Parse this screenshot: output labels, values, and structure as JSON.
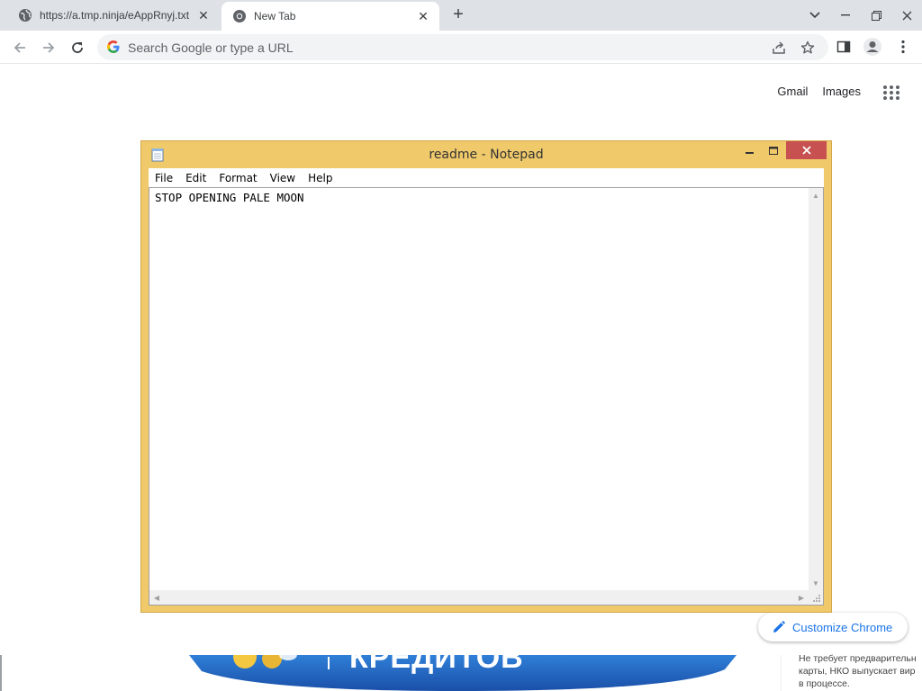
{
  "browser": {
    "tabs": [
      {
        "title": "https://a.tmp.ninja/eAppRnyj.txt",
        "icon": "globe-icon",
        "active": false
      },
      {
        "title": "New Tab",
        "icon": "chrome-icon",
        "active": true
      }
    ],
    "omnibox": {
      "placeholder": "Search Google or type a URL"
    }
  },
  "ntp": {
    "gmail": "Gmail",
    "images": "Images",
    "customize": "Customize Chrome"
  },
  "notepad": {
    "title": "readme - Notepad",
    "menu": [
      "File",
      "Edit",
      "Format",
      "View",
      "Help"
    ],
    "content": "STOP OPENING PALE MOON"
  },
  "ad": {
    "banner_text": "КРЕДИТОВ",
    "side_text": [
      "Не требует предварительн",
      "карты, НКО выпускает вир",
      "в процессе."
    ]
  },
  "colors": {
    "notepad_frame": "#f0c96b",
    "close_button": "#c75050",
    "link_blue": "#1a73e8",
    "tabstrip": "#dee1e6"
  }
}
